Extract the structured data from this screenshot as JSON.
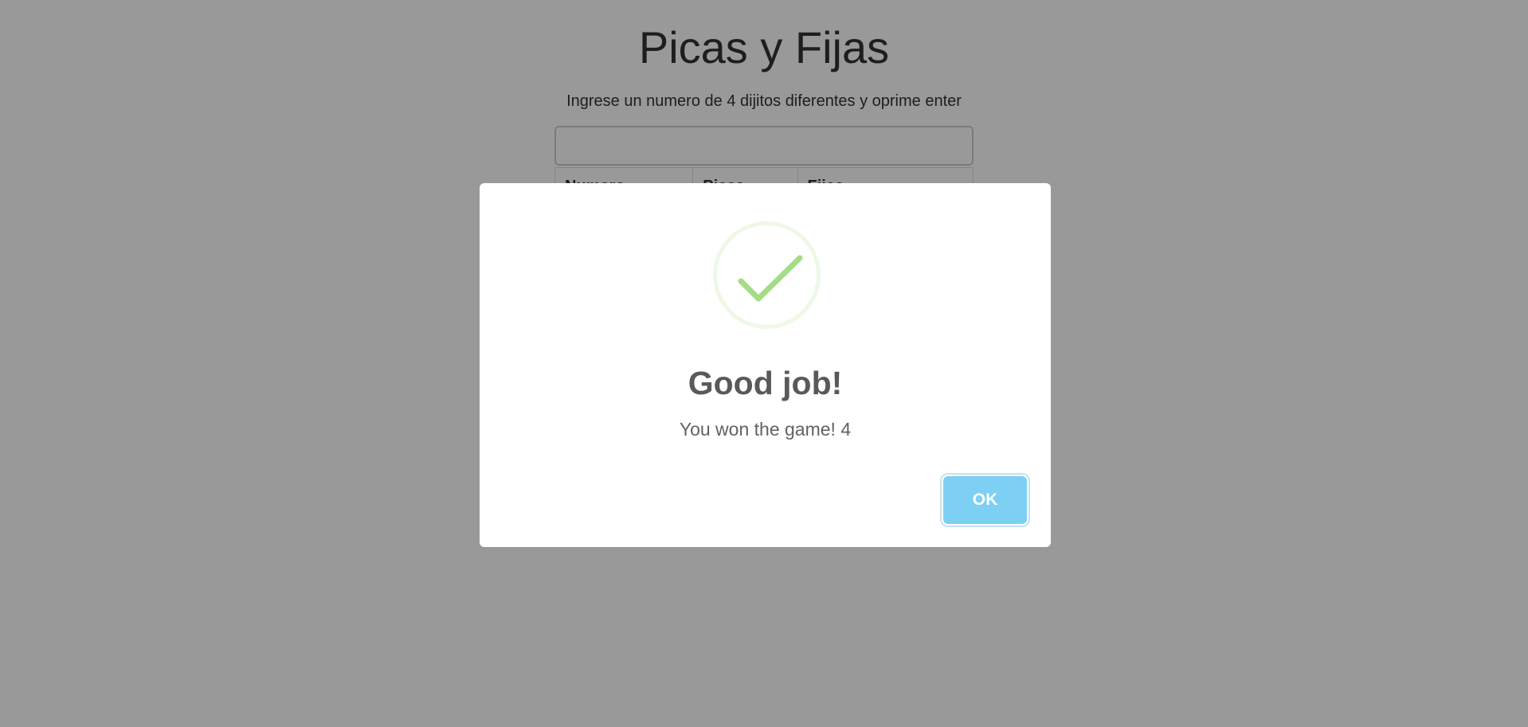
{
  "page": {
    "title": "Picas y Fijas",
    "instructions": "Ingrese un numero de 4 dijitos diferentes y oprime enter",
    "guess_input_value": "",
    "table": {
      "headers": [
        "Numero",
        "Picas",
        "Fijas"
      ]
    }
  },
  "dialog": {
    "icon": "success-check-icon",
    "title": "Good job!",
    "text": "You won the game! 4",
    "ok_label": "OK",
    "colors": {
      "check": "#a5dc86",
      "check_ring": "#eef8e6",
      "button": "#7ecff4",
      "overlay": "rgba(0,0,0,0.4)"
    }
  }
}
